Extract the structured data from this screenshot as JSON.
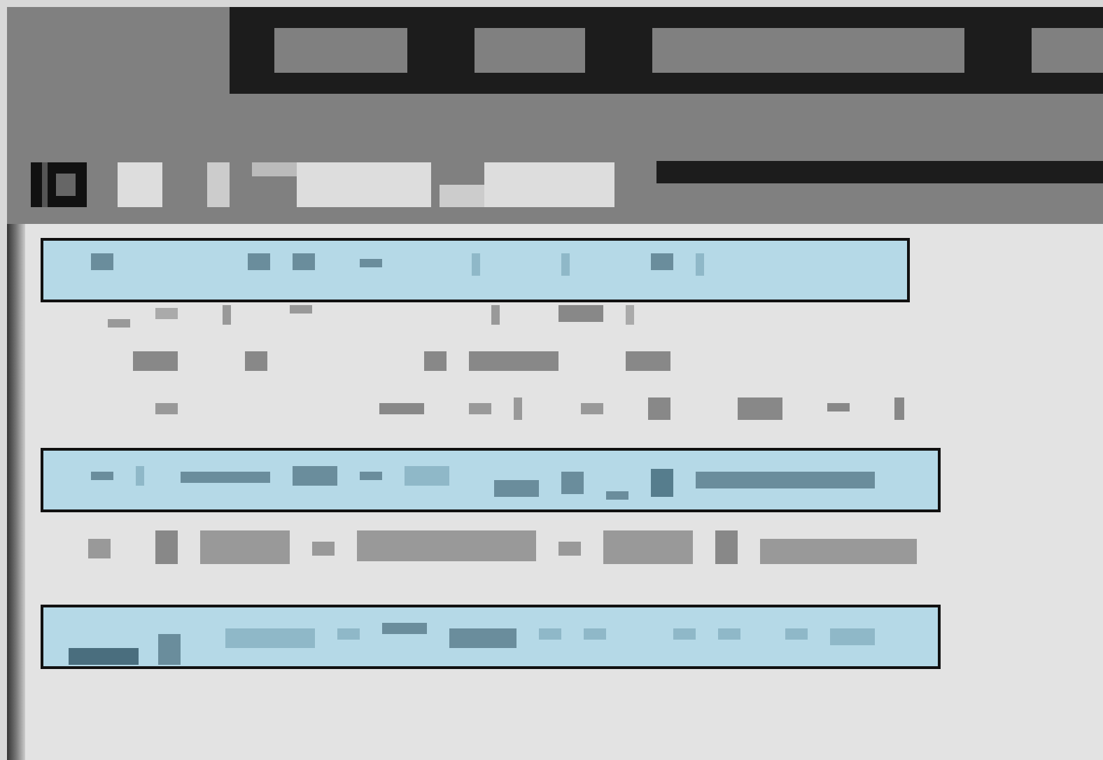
{
  "tab_bar": {
    "tabs": [
      {
        "selected": false
      },
      {
        "selected": false
      },
      {
        "selected": false
      },
      {
        "selected": false
      }
    ]
  },
  "list": {
    "rows": [
      {
        "selected": true
      },
      {
        "selected": false
      },
      {
        "selected": false
      },
      {
        "selected": false
      },
      {
        "selected": true
      },
      {
        "selected": false
      },
      {
        "selected": true
      }
    ]
  }
}
